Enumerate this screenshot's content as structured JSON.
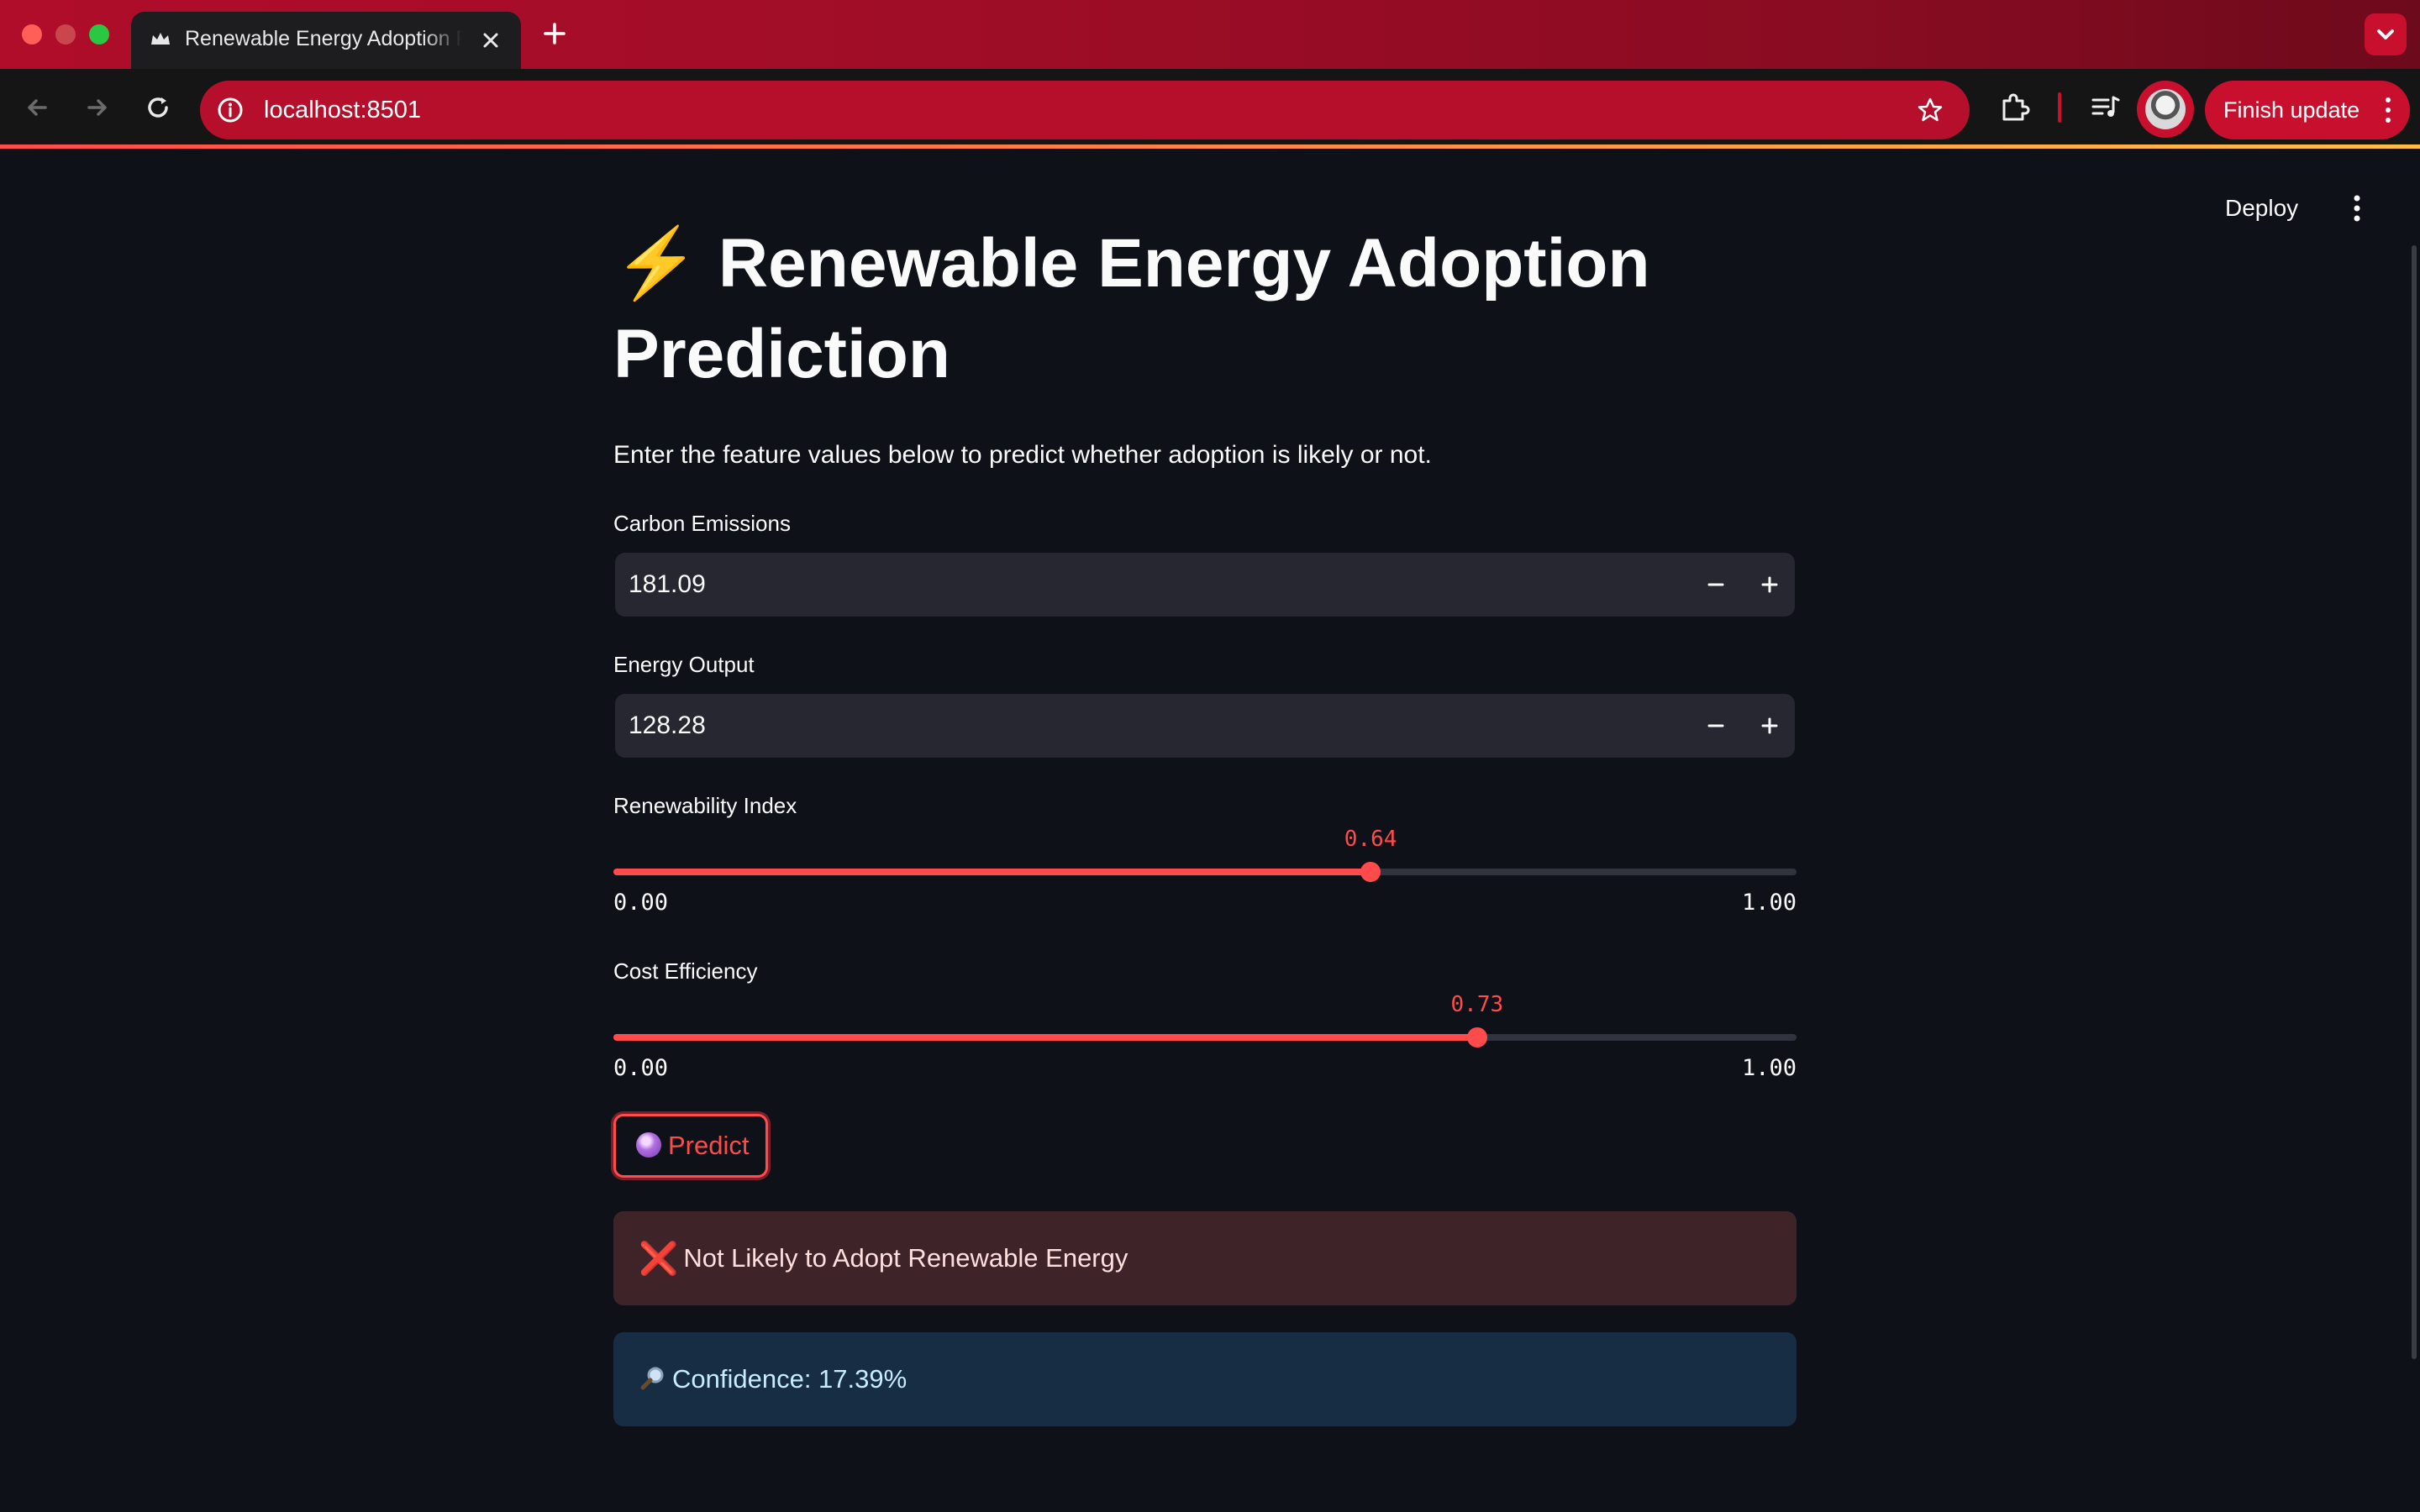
{
  "browser": {
    "tab_title": "Renewable Energy Adoption Prediction",
    "url": "localhost:8501",
    "finish_update_label": "Finish update"
  },
  "header": {
    "deploy_label": "Deploy"
  },
  "app": {
    "title_icon": "⚡",
    "title": "Renewable Energy Adoption Prediction",
    "subtitle": "Enter the feature values below to predict whether adoption is likely or not.",
    "carbon_emissions": {
      "label": "Carbon Emissions",
      "value": "181.09"
    },
    "energy_output": {
      "label": "Energy Output",
      "value": "128.28"
    },
    "renewability_index": {
      "label": "Renewability Index",
      "value": 0.64,
      "value_text": "0.64",
      "min": "0.00",
      "max": "1.00"
    },
    "cost_efficiency": {
      "label": "Cost Efficiency",
      "value": 0.73,
      "value_text": "0.73",
      "min": "0.00",
      "max": "1.00"
    },
    "predict_label": "Predict",
    "predict_icon": "crystal-ball-icon",
    "result_icon": "❌",
    "result_text": "Not Likely to Adopt Renewable Energy",
    "confidence_icon": "magnifying-glass-icon",
    "confidence_text": "Confidence: 17.39%"
  },
  "colors": {
    "accent": "#ff4b4b",
    "background": "#0e1117",
    "input_bg": "#262730",
    "error_bg": "#3e2428",
    "info_bg": "#172d43",
    "chrome_red": "#c8102e"
  }
}
